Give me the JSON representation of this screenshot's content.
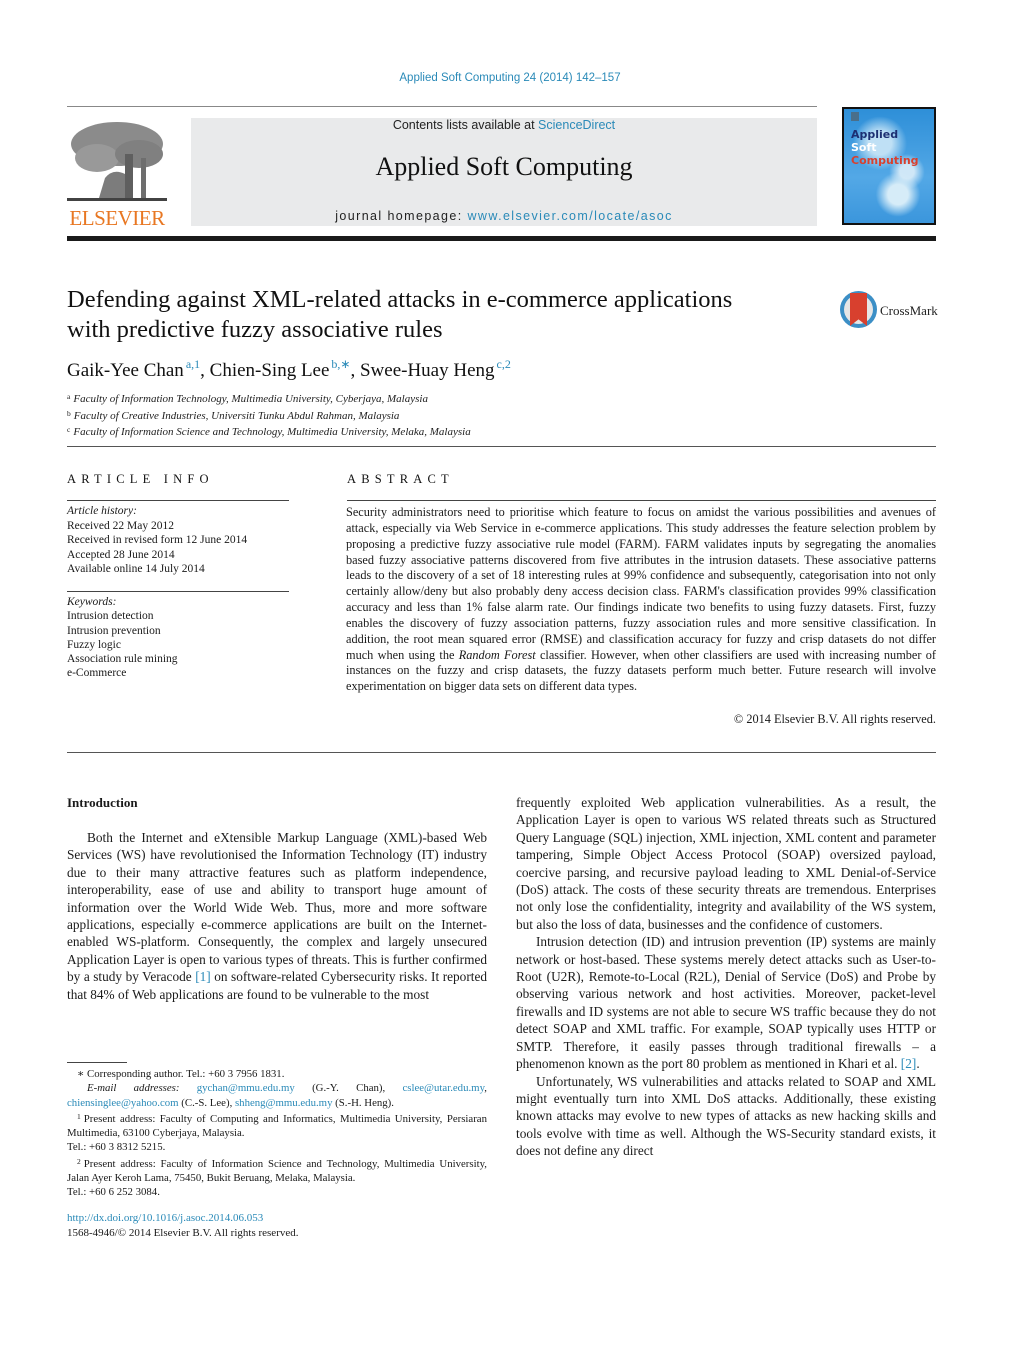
{
  "header": {
    "journal_ref": "Applied Soft Computing 24 (2014) 142–157",
    "contents_prefix": "Contents lists available at ",
    "contents_link": "ScienceDirect",
    "journal_title": "Applied Soft Computing",
    "homepage_prefix": "journal homepage: ",
    "homepage_link": "www.elsevier.com/locate/asoc",
    "publisher_logo": "ELSEVIER",
    "cover": {
      "line1": "Applied",
      "line2": "Soft",
      "line3": "Computing"
    },
    "colors": {
      "link": "#2a8ab8",
      "elsevier_orange": "#e87722",
      "banner_bg": "#e9eaeb"
    }
  },
  "article": {
    "title_line1": "Defending against XML-related attacks in e-commerce applications",
    "title_line2": "with predictive fuzzy associative rules",
    "crossmark_label": "CrossMark",
    "authors": [
      {
        "name": "Gaik-Yee Chan",
        "marks": "a,1"
      },
      {
        "name": "Chien-Sing Lee",
        "marks": "b,∗"
      },
      {
        "name": "Swee-Huay Heng",
        "marks": "c,2"
      }
    ],
    "affiliations": [
      {
        "mark": "a",
        "text": "Faculty of Information Technology, Multimedia University, Cyberjaya, Malaysia"
      },
      {
        "mark": "b",
        "text": "Faculty of Creative Industries, Universiti Tunku Abdul Rahman, Malaysia"
      },
      {
        "mark": "c",
        "text": "Faculty of Information Science and Technology, Multimedia University, Melaka, Malaysia"
      }
    ]
  },
  "article_info": {
    "heading": "ARTICLE INFO",
    "history_label": "Article history:",
    "history": [
      "Received 22 May 2012",
      "Received in revised form 12 June 2014",
      "Accepted 28 June 2014",
      "Available online 14 July 2014"
    ],
    "keywords_label": "Keywords:",
    "keywords": [
      "Intrusion detection",
      "Intrusion prevention",
      "Fuzzy logic",
      "Association rule mining",
      "e-Commerce"
    ]
  },
  "abstract": {
    "heading": "ABSTRACT",
    "text_before_italic": "Security administrators need to prioritise which feature to focus on amidst the various possibilities and avenues of attack, especially via Web Service in e-commerce applications. This study addresses the feature selection problem by proposing a predictive fuzzy associative rule model (FARM). FARM validates inputs by segregating the anomalies based fuzzy associative patterns discovered from five attributes in the intrusion datasets. These associative patterns leads to the discovery of a set of 18 interesting rules at 99% confidence and subsequently, categorisation into not only certainly allow/deny but also probably deny access decision class. FARM's classification provides 99% classification accuracy and less than 1% false alarm rate. Our findings indicate two benefits to using fuzzy datasets. First, fuzzy enables the discovery of fuzzy association patterns, fuzzy association rules and more sensitive classification. In addition, the root mean squared error (RMSE) and classification accuracy for fuzzy and crisp datasets do not differ much when using the ",
    "italic": "Random Forest",
    "text_after_italic": " classifier. However, when other classifiers are used with increasing number of instances on the fuzzy and crisp datasets, the fuzzy datasets perform much better. Future research will involve experimentation on bigger data sets on different data types.",
    "copyright": "© 2014 Elsevier B.V. All rights reserved."
  },
  "body": {
    "section_heading": "Introduction",
    "left_p1_a": "Both the Internet and eXtensible Markup Language (XML)-based Web Services (WS) have revolutionised the Information Technology (IT) industry due to their many attractive features such as platform independence, interoperability, ease of use and ability to transport huge amount of information over the World Wide Web. Thus, more and more software applications, especially e-commerce applications are built on the Internet-enabled WS-platform. Consequently, the complex and largely unsecured Application Layer is open to various types of threats. This is further confirmed by a study by Veracode ",
    "ref1": "[1]",
    "left_p1_b": " on software-related Cybersecurity risks. It reported that 84% of Web applications are found to be vulnerable to the most",
    "right_p1": "frequently exploited Web application vulnerabilities. As a result, the Application Layer is open to various WS related threats such as Structured Query Language (SQL) injection, XML injection, XML content and parameter tampering, Simple Object Access Protocol (SOAP) oversized payload, coercive parsing, and recursive payload leading to XML Denial-of-Service (DoS) attack. The costs of these security threats are tremendous. Enterprises not only lose the confidentiality, integrity and availability of the WS system, but also the loss of data, businesses and the confidence of customers.",
    "right_p2_a": "Intrusion detection (ID) and intrusion prevention (IP) systems are mainly network or host-based. These systems merely detect attacks such as User-to-Root (U2R), Remote-to-Local (R2L), Denial of Service (DoS) and Probe by observing various network and host activities. Moreover, packet-level firewalls and ID systems are not able to secure WS traffic because they do not detect SOAP and XML traffic. For example, SOAP typically uses HTTP or SMTP. Therefore, it easily passes through traditional firewalls – a phenomenon known as the port 80 problem as mentioned in Khari et al. ",
    "ref2": "[2]",
    "right_p2_b": ".",
    "right_p3": "Unfortunately, WS vulnerabilities and attacks related to SOAP and XML might eventually turn into XML DoS attacks. Additionally, these existing known attacks may evolve to new types of attacks as new hacking skills and tools evolve with time as well. Although the WS-Security standard exists, it does not define any direct"
  },
  "footnotes": {
    "corresponding": "∗  Corresponding author. Tel.: +60 3 7956 1831.",
    "email_label": "E-mail addresses:",
    "email1": "gychan@mmu.edu.my",
    "email1_owner": " (G.-Y. Chan), ",
    "email2": "cslee@utar.edu.my",
    "email2_sep": ", ",
    "email3": "chiensinglee@yahoo.com",
    "email3_owner": " (C.-S. Lee), ",
    "email4": "shheng@mmu.edu.my",
    "email4_owner": " (S.-H. Heng).",
    "fn1_mark": "1",
    "fn1": "Present address: Faculty of Computing and Informatics, Multimedia University, Persiaran Multimedia, 63100 Cyberjaya, Malaysia.",
    "fn1_tel": "Tel.: +60 3 8312 5215.",
    "fn2_mark": "2",
    "fn2": "Present address: Faculty of Information Science and Technology, Multimedia University, Jalan Ayer Keroh Lama, 75450, Bukit Beruang, Melaka, Malaysia.",
    "fn2_tel": "Tel.: +60 6 252 3084."
  },
  "doi": {
    "link": "http://dx.doi.org/10.1016/j.asoc.2014.06.053",
    "issn": "1568-4946/© 2014 Elsevier B.V. All rights reserved."
  }
}
